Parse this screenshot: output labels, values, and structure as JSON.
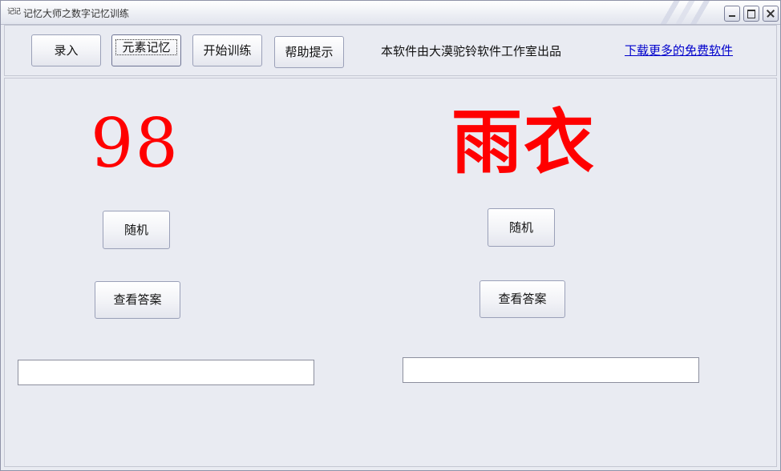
{
  "window": {
    "title": "记忆大师之数字记忆训练",
    "icon_text": "记记"
  },
  "toolbar": {
    "buttons": [
      {
        "label": "录入"
      },
      {
        "label": "元素记忆"
      },
      {
        "label": "开始训练"
      },
      {
        "label": "帮助提示"
      }
    ],
    "credit": "本软件由大漠驼铃软件工作室出品",
    "download_link": "下载更多的免费软件"
  },
  "left_panel": {
    "number": "98",
    "random_label": "随机",
    "answer_label": "查看答案",
    "answer_value": ""
  },
  "right_panel": {
    "word": "雨衣",
    "random_label": "随机",
    "answer_label": "查看答案",
    "answer_value": ""
  },
  "colors": {
    "display_text": "#ff0000",
    "link": "#0000cc",
    "background": "#e9ebf2"
  }
}
